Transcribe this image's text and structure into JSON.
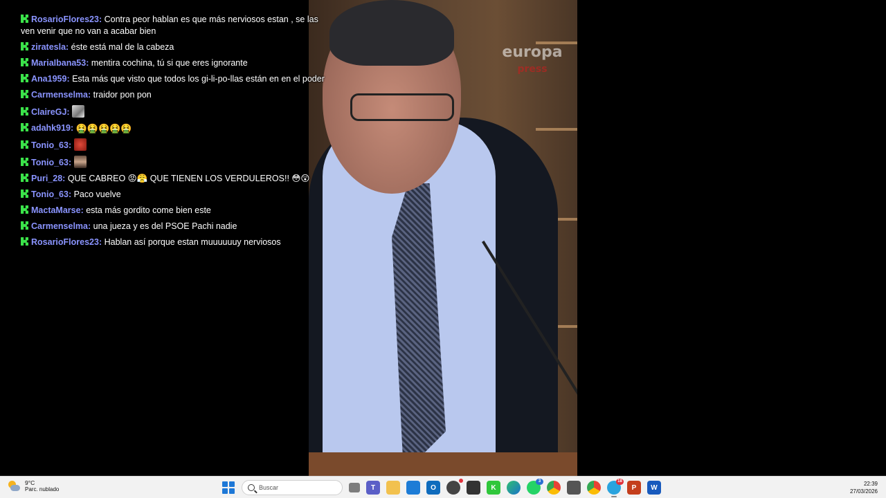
{
  "video": {
    "watermark_line1": "europa",
    "watermark_line2": "press"
  },
  "chat": {
    "messages": [
      {
        "user": "RosarioFlores23",
        "text": "Contra peor hablan es que más nerviosos estan , se las ven venir que no van a acabar bien"
      },
      {
        "user": "ziratesla",
        "text": "éste está mal de la cabeza"
      },
      {
        "user": "MariaIbana53",
        "text": "mentira cochina, tú si que eres ignorante"
      },
      {
        "user": "Ana1959",
        "text": "Esta más que visto que todos los gi-li-po-llas están en en el poder"
      },
      {
        "user": "Carmenselma",
        "text": "traidor pon pon"
      },
      {
        "user": "ClaireGJ",
        "text": ""
      },
      {
        "user": "adahk919",
        "text": "🤮🤮🤮🤮🤮"
      },
      {
        "user": "Tonio_63",
        "text": ""
      },
      {
        "user": "Tonio_63",
        "text": ""
      },
      {
        "user": "Puri_28",
        "text": "QUE CABREO 😡😤 QUE TIENEN LOS VERDULEROS!! 😳😲"
      },
      {
        "user": "Tonio_63",
        "text": "Paco vuelve"
      },
      {
        "user": "MactaMarse",
        "text": "esta más gordito come bien este"
      },
      {
        "user": "Carmenselma",
        "text": "una jueza y es del PSOE Pachi nadie"
      },
      {
        "user": "RosarioFlores23",
        "text": "Hablan así porque estan muuuuuuy nerviosos"
      }
    ]
  },
  "taskbar": {
    "weather_temp": "9°C",
    "weather_desc": "Parc. nublado",
    "search_placeholder": "Buscar",
    "time": "22:39",
    "date": "27/03/2026",
    "telegram_badge": "18",
    "whatsapp_badge": "3",
    "accent": "#1e78d7"
  }
}
